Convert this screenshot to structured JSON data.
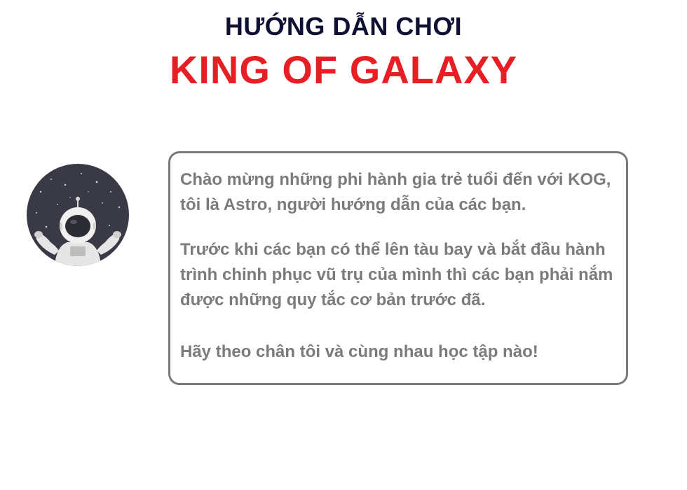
{
  "header": {
    "subtitle": "HƯỚNG DẪN CHƠI",
    "title": "KING OF GALAXY"
  },
  "guide": {
    "avatar_icon": "astronaut-icon",
    "paragraphs": [
      "Chào mừng những phi hành gia trẻ tuổi đến với KOG, tôi là Astro, người hướng dẫn của các bạn.",
      "Trước khi các bạn có thể lên tàu bay và bắt đầu hành trình chinh phục vũ trụ của mình thì các bạn phải nắm được những quy tắc cơ bản trước đã.",
      "Hãy theo chân tôi và cùng nhau học tập nào!"
    ]
  },
  "colors": {
    "subtitle": "#0d1033",
    "title": "#e81e25",
    "text": "#7b7b7b",
    "border": "#7a7a7a",
    "avatar_bg": "#3a3a46"
  }
}
